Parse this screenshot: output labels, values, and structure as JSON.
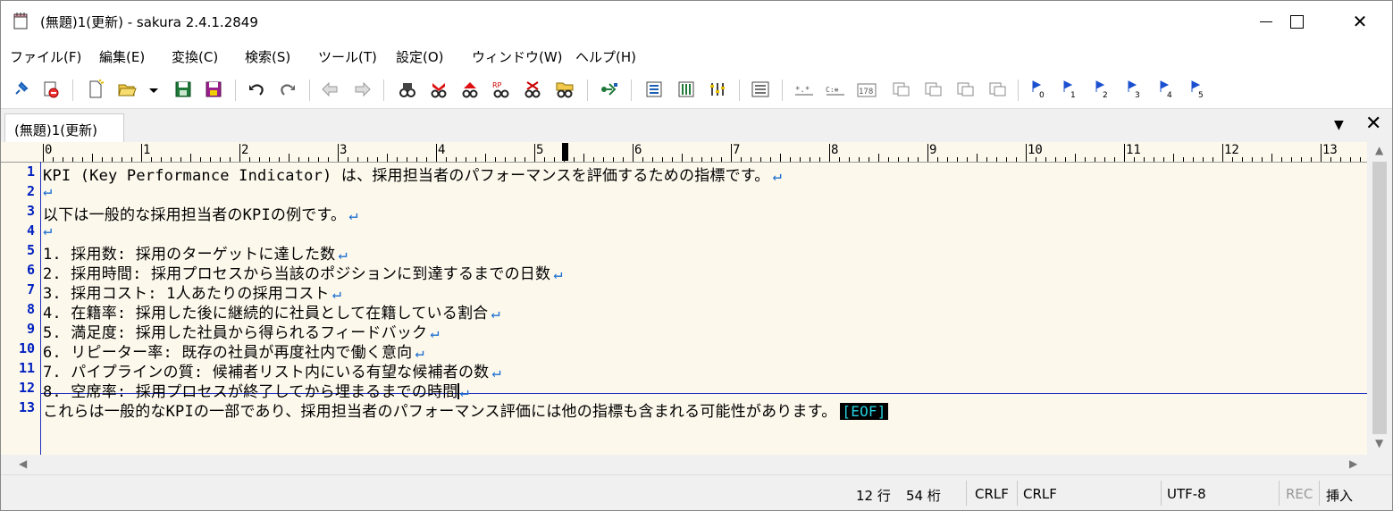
{
  "window": {
    "title": "(無題)1(更新) - sakura 2.4.1.2849",
    "minimize_label": "—",
    "close_label": "✕"
  },
  "menu": [
    "ファイル(F)",
    "編集(E)",
    "変換(C)",
    "検索(S)",
    "ツール(T)",
    "設定(O)",
    "ウィンドウ(W)",
    "ヘルプ(H)"
  ],
  "toolbar_icons": [
    "pin-icon",
    "print-preview-icon",
    "new-file-icon",
    "open-folder-icon",
    "dropdown-arrow-icon",
    "save-icon",
    "save-all-icon",
    "undo-icon",
    "redo-icon",
    "back-icon",
    "forward-icon",
    "search-icon",
    "search-next-icon",
    "search-prev-icon",
    "replace-icon",
    "clear-marks-icon",
    "grep-icon",
    "jump-icon",
    "outline-icon",
    "function-list-icon",
    "settings-icon",
    "compare-icon",
    "text-wrap-icon",
    "char-code-icon",
    "tag-icon",
    "convert-case-icon",
    "convert-halfwidth-icon",
    "convert-fullwidth-icon",
    "convert-kana-icon",
    "bookmark-0-icon",
    "bookmark-1-icon",
    "bookmark-2-icon",
    "bookmark-3-icon",
    "bookmark-4-icon",
    "bookmark-5-icon"
  ],
  "toolbar_text": {
    "star": "*.*",
    "code": "C:≡",
    "num": "178",
    "b0": "0",
    "b1": "1",
    "b2": "2",
    "b3": "3",
    "b4": "4",
    "b5": "5"
  },
  "tab": {
    "label": "(無題)1(更新)",
    "dropdown": "▼",
    "close": "✕"
  },
  "ruler": [
    "0",
    "1",
    "2",
    "3",
    "4",
    "5",
    "6",
    "7",
    "8",
    "9",
    "10",
    "11",
    "12",
    "13"
  ],
  "newline_mark": "↵",
  "editor_lines": [
    {
      "num": "1",
      "text": "KPI (Key Performance Indicator) は、採用担当者のパフォーマンスを評価するための指標です。"
    },
    {
      "num": "2",
      "text": ""
    },
    {
      "num": "3",
      "text": "以下は一般的な採用担当者のKPIの例です。"
    },
    {
      "num": "4",
      "text": ""
    },
    {
      "num": "5",
      "text": "1. 採用数: 採用のターゲットに達した数"
    },
    {
      "num": "6",
      "text": "2. 採用時間: 採用プロセスから当該のポジションに到達するまでの日数"
    },
    {
      "num": "7",
      "text": "3. 採用コスト: 1人あたりの採用コスト"
    },
    {
      "num": "8",
      "text": "4. 在籍率: 採用した後に継続的に社員として在籍している割合"
    },
    {
      "num": "9",
      "text": "5. 満足度: 採用した社員から得られるフィードバック"
    },
    {
      "num": "10",
      "text": "6. リピーター率: 既存の社員が再度社内で働く意向"
    },
    {
      "num": "11",
      "text": "7. パイプラインの質: 候補者リスト内にいる有望な候補者の数"
    },
    {
      "num": "12",
      "text": "8. 空席率: 採用プロセスが終了してから埋まるまでの時間"
    },
    {
      "num": "13",
      "text": "これらは一般的なKPIの一部であり、採用担当者のパフォーマンス評価には他の指標も含まれる可能性があります。"
    }
  ],
  "eof_marker": "[EOF]",
  "status": {
    "line": "12 行",
    "col": "54 桁",
    "eol1": "CRLF",
    "eol2": "CRLF",
    "encoding": "UTF-8",
    "rec": "REC",
    "insert_mode": "挿入"
  }
}
